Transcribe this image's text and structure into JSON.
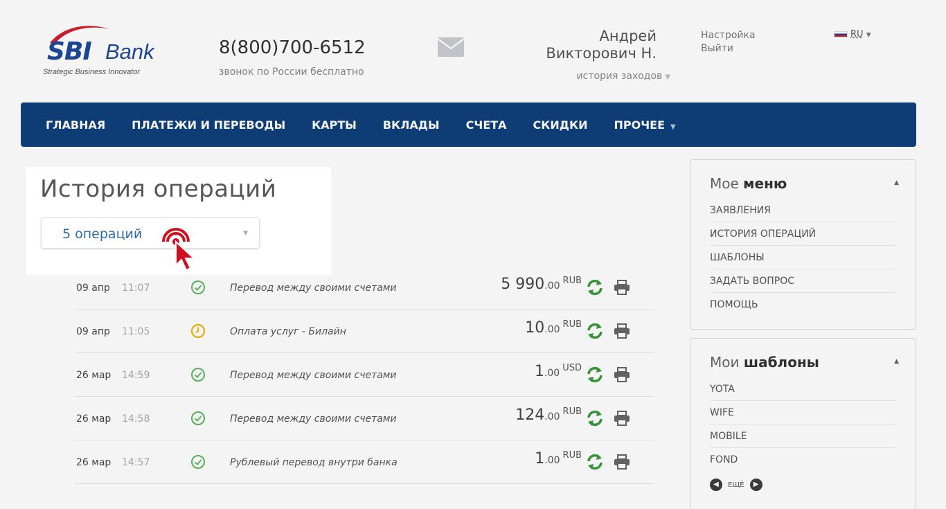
{
  "header": {
    "logo_sbi": "SBI",
    "logo_bank": "Bank",
    "logo_tagline": "Strategic Business Innovator",
    "phone": "8(800)700-6512",
    "phone_note": "звонок по России бесплатно",
    "user_first": "Андрей",
    "user_last": "Викторович Н.",
    "history_link": "история заходов",
    "settings": "Настройка",
    "logout": "Выйти",
    "language": "RU"
  },
  "nav": {
    "items": [
      "ГЛАВНАЯ",
      "ПЛАТЕЖИ И ПЕРЕВОДЫ",
      "КАРТЫ",
      "ВКЛАДЫ",
      "СЧЕТА",
      "СКИДКИ",
      "ПРОЧЕЕ"
    ]
  },
  "page": {
    "title": "История операций",
    "filter_value": "5 операций"
  },
  "operations": [
    {
      "date": "09 апр",
      "time": "11:07",
      "status": "done",
      "description": "Перевод между своими счетами",
      "amount_int": "5 990",
      "amount_cents": ".00",
      "currency": "RUB"
    },
    {
      "date": "09 апр",
      "time": "11:05",
      "status": "pending",
      "description": "Оплата услуг - Билайн",
      "amount_int": "10",
      "amount_cents": ".00",
      "currency": "RUB"
    },
    {
      "date": "26 мар",
      "time": "14:59",
      "status": "done",
      "description": "Перевод между своими счетами",
      "amount_int": "1",
      "amount_cents": ".00",
      "currency": "USD"
    },
    {
      "date": "26 мар",
      "time": "14:58",
      "status": "done",
      "description": "Перевод между своими счетами",
      "amount_int": "124",
      "amount_cents": ".00",
      "currency": "RUB"
    },
    {
      "date": "26 мар",
      "time": "14:57",
      "status": "done",
      "description": "Рублевый перевод внутри банка",
      "amount_int": "1",
      "amount_cents": ".00",
      "currency": "RUB"
    }
  ],
  "sidebar": {
    "menu_title_plain": "Мое",
    "menu_title_bold": "меню",
    "menu_items": [
      "ЗАЯВЛЕНИЯ",
      "ИСТОРИЯ ОПЕРАЦИЙ",
      "ШАБЛОНЫ",
      "ЗАДАТЬ ВОПРОС",
      "ПОМОЩЬ"
    ],
    "templates_title_plain": "Мои",
    "templates_title_bold": "шаблоны",
    "template_items": [
      "YOTA",
      "WIFE",
      "MOBILE",
      "FOND"
    ],
    "more_label": "ЕЩЁ"
  },
  "colors": {
    "nav_bg": "#0f3f7a",
    "status_done": "#5cb85c",
    "status_pending": "#f0b400",
    "repeat_icon": "#3a9a3a",
    "link_blue": "#2b6ca8",
    "pointer_red": "#d0101e"
  }
}
